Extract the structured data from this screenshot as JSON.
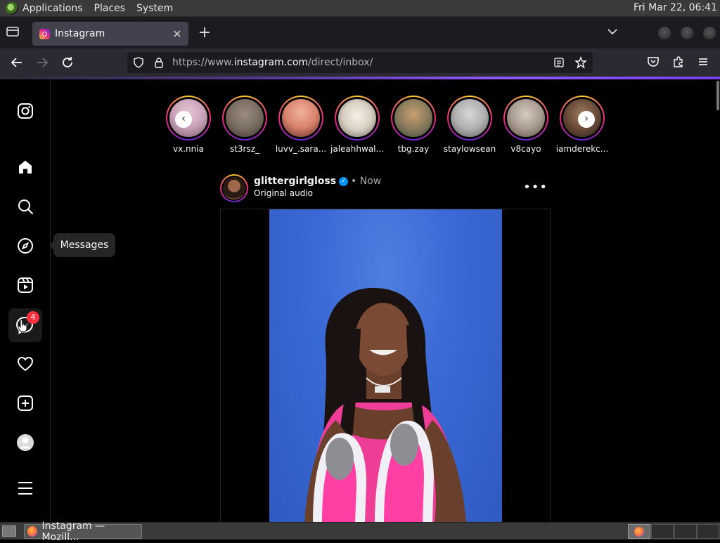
{
  "topbar": {
    "menus": [
      "Applications",
      "Places",
      "System"
    ],
    "clock": "Fri Mar 22, 06:41"
  },
  "browser": {
    "tab_title": "Instagram",
    "url_prefix": "https://www.",
    "url_domain": "instagram.com",
    "url_path": "/direct/inbox/"
  },
  "stories": [
    {
      "name": "vx.nnia",
      "color": "#c9a0b8"
    },
    {
      "name": "st3rsz_",
      "color": "#7a6d62"
    },
    {
      "name": "luvv_.sara...",
      "color": "#d9826c"
    },
    {
      "name": "jaleahhwal...",
      "color": "#d8cfc2"
    },
    {
      "name": "tbg.zay",
      "color": "#8a7a5c"
    },
    {
      "name": "staylowsean",
      "color": "#b0b0b0"
    },
    {
      "name": "v8cayo",
      "color": "#a89c90"
    },
    {
      "name": "iamderekc...",
      "color": "#6a4c3a"
    }
  ],
  "post": {
    "username": "glittergirlgloss",
    "time": "• Now",
    "audio": "Original audio",
    "more": "•••"
  },
  "sidebar": {
    "messages_badge": "4",
    "tooltip": "Messages"
  },
  "taskbar": {
    "task_label": "Instagram — Mozill..."
  }
}
